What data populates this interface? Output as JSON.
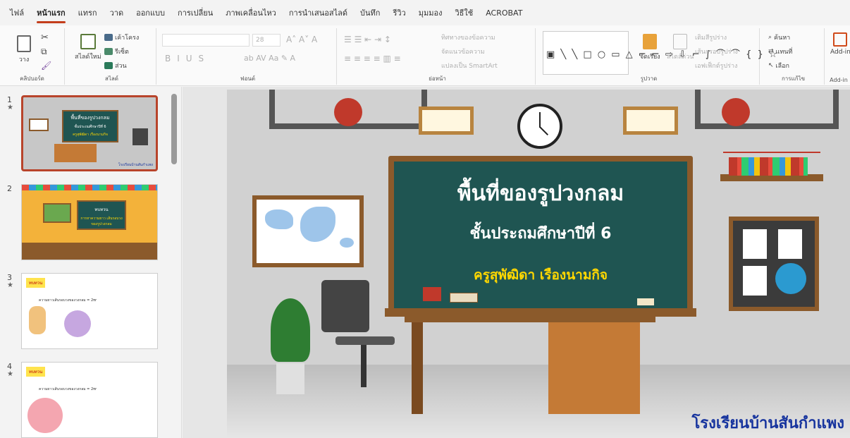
{
  "tabs": [
    "ไฟล์",
    "หน้าแรก",
    "แทรก",
    "วาด",
    "ออกแบบ",
    "การเปลี่ยน",
    "ภาพเคลื่อนไหว",
    "การนำเสนอสไลด์",
    "บันทึก",
    "รีวิว",
    "มุมมอง",
    "วิธีใช้",
    "ACROBAT"
  ],
  "ribbon": {
    "clipboard": {
      "paste": "วาง",
      "label": "คลิปบอร์ด"
    },
    "slides": {
      "new": "สไลด์ใหม่",
      "layout": "เค้าโครง",
      "reset": "รีเซ็ต",
      "section": "ส่วน",
      "label": "สไลด์"
    },
    "font": {
      "size": "28",
      "label": "ฟอนต์"
    },
    "paragraph": {
      "direction": "ทิศทางของข้อความ",
      "align": "จัดแนวข้อความ",
      "smartart": "แปลงเป็น SmartArt",
      "label": "ย่อหน้า"
    },
    "drawing": {
      "arrange": "จัดเรียง",
      "styles": "สไตล์ด่วน",
      "fill": "เติมสีรูปร่าง",
      "outline": "เส้นกรอบรูปร่าง",
      "effects": "เอฟเฟ็กต์รูปร่าง",
      "label": "รูปวาด"
    },
    "editing": {
      "find": "ค้นหา",
      "replace": "แทนที่",
      "select": "เลือก",
      "label": "การแก้ไข"
    },
    "addin": {
      "addin": "Add-in",
      "label": "Add-in"
    }
  },
  "thumbnails": [
    {
      "num": "1",
      "star": "★",
      "title": "พื้นที่ของรูปวงกลม",
      "sub": "ชั้นประถมศึกษาปีที่ 6",
      "teacher": "ครูสุพัฒิดา เรืองนามกิจ",
      "school": "โรงเรียนบ้านสันกำแพง"
    },
    {
      "num": "2",
      "star": "",
      "title": "ทบทวน",
      "sub": "การหาความยาว เส้นรอบวงของรูปวงกลม"
    },
    {
      "num": "3",
      "star": "★",
      "title": "ทบทวน",
      "sub": "ความยาวเส้นรอบวงของวงกลม = 2πr"
    },
    {
      "num": "4",
      "star": "★",
      "title": "ทบทวน",
      "sub": "ความยาวเส้นรอบวงของวงกลม = 2πr"
    }
  ],
  "slide": {
    "title": "พื้นที่ของรูปวงกลม",
    "grade": "ชั้นประถมศึกษาปีที่ 6",
    "teacher": "ครูสุพัฒิดา เรืองนามกิจ",
    "school": "โรงเรียนบ้านสันกำแพง"
  }
}
